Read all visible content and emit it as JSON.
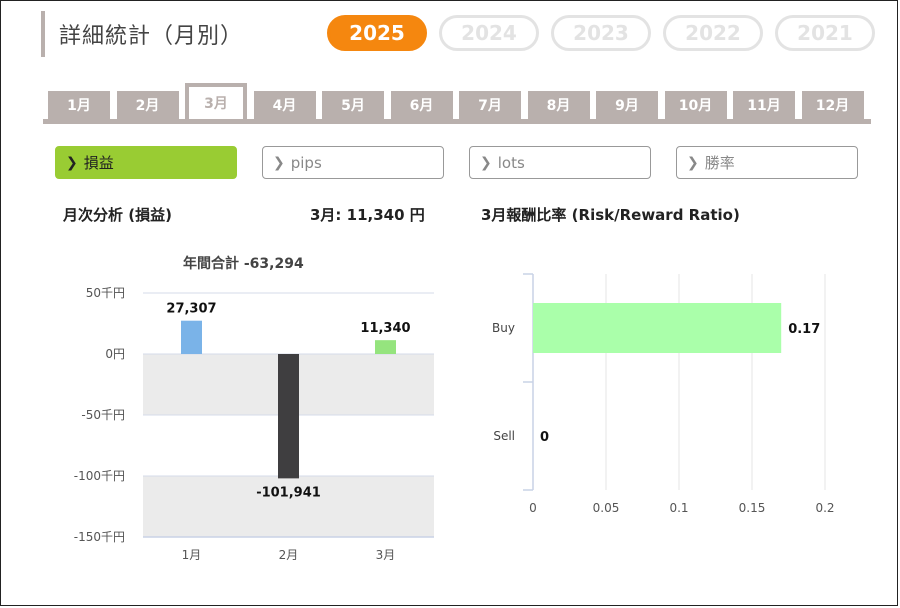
{
  "page": {
    "title": "詳細統計（月別）"
  },
  "years": [
    {
      "label": "2025",
      "active": true
    },
    {
      "label": "2024",
      "active": false
    },
    {
      "label": "2023",
      "active": false
    },
    {
      "label": "2022",
      "active": false
    },
    {
      "label": "2021",
      "active": false
    }
  ],
  "months": [
    "1月",
    "2月",
    "3月",
    "4月",
    "5月",
    "6月",
    "7月",
    "8月",
    "9月",
    "10月",
    "11月",
    "12月"
  ],
  "active_month_index": 2,
  "metrics": [
    {
      "label": "損益",
      "active": true
    },
    {
      "label": "pips",
      "active": false
    },
    {
      "label": "lots",
      "active": false
    },
    {
      "label": "勝率",
      "active": false
    }
  ],
  "left_section": {
    "title": "月次分析 (損益)",
    "month_summary": "3月:  11,340 円",
    "annual_total": "年間合計 -63,294"
  },
  "right_section": {
    "title": "3月報酬比率 (Risk/Reward Ratio)"
  },
  "colors": {
    "accent_orange": "#f5870f",
    "accent_green": "#99cc33",
    "tab_gray": "#b9b0ad"
  },
  "chart_data": [
    {
      "type": "bar",
      "categories": [
        "1月",
        "2月",
        "3月"
      ],
      "values": [
        27307,
        -101941,
        11340
      ],
      "value_labels": [
        "27,307",
        "-101,941",
        "11,340"
      ],
      "bar_colors": [
        "#7ab3e8",
        "#3f3e40",
        "#95e47e"
      ],
      "ylim": [
        -150000,
        50000
      ],
      "yticks": [
        50000,
        0,
        -50000,
        -100000,
        -150000
      ],
      "ytick_labels": [
        "50千円",
        "0円",
        "-50千円",
        "-100千円",
        "-150千円"
      ],
      "grid": true
    },
    {
      "type": "bar",
      "orientation": "horizontal",
      "categories": [
        "Buy",
        "Sell"
      ],
      "values": [
        0.17,
        0
      ],
      "value_labels": [
        "0.17",
        "0"
      ],
      "bar_color": "#aaffaa",
      "xlim": [
        0,
        0.2
      ],
      "xticks": [
        0,
        0.05,
        0.1,
        0.15,
        0.2
      ],
      "xtick_labels": [
        "0",
        "0.05",
        "0.1",
        "0.15",
        "0.2"
      ],
      "grid": true
    }
  ]
}
